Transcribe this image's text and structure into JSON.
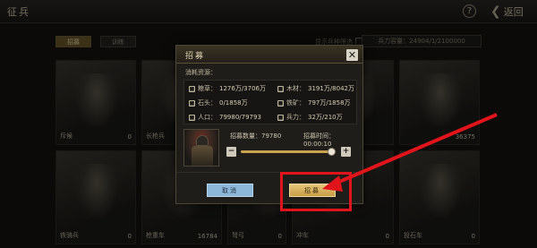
{
  "header": {
    "title": "征兵",
    "help_label": "?",
    "back_label": "返回"
  },
  "tabs": [
    {
      "label": "招募"
    },
    {
      "label": "训练"
    }
  ],
  "filter": {
    "label": "显示兵种筛选"
  },
  "troops_total": "兵力容量：24904/1/2100000",
  "troops": [
    {
      "name": "斥候",
      "count": "0"
    },
    {
      "name": "长枪兵",
      "count": "0"
    },
    {
      "name": "",
      "count": ""
    },
    {
      "name": "",
      "count": ""
    },
    {
      "name": "",
      "count": ""
    },
    {
      "name": "",
      "count": "36375"
    },
    {
      "name": "铁骑兵",
      "count": "0"
    },
    {
      "name": "枪重车",
      "count": "16784"
    },
    {
      "name": "弩弓",
      "count": "0"
    },
    {
      "name": "冲车",
      "count": "0"
    },
    {
      "name": "",
      "count": "0"
    },
    {
      "name": "投石车",
      "count": "0"
    }
  ],
  "dialog": {
    "title": "招募",
    "consume_label": "消耗资源：",
    "resources": [
      {
        "icon": "grain-icon",
        "label": "粮草：",
        "value": "1276万/3706万"
      },
      {
        "icon": "wood-icon",
        "label": "木材：",
        "value": "3191万/8042万"
      },
      {
        "icon": "stone-icon",
        "label": "石头：",
        "value": "0/1858万"
      },
      {
        "icon": "iron-icon",
        "label": "铁矿：",
        "value": "797万/1858万"
      },
      {
        "icon": "population-icon",
        "label": "人口：",
        "value": "79980/79793"
      },
      {
        "icon": "troops-icon",
        "label": "兵力：",
        "value": "32万/210万"
      }
    ],
    "recruit_amount_label": "招募数量：",
    "recruit_amount": "79780",
    "recruit_time_label": "招募时间：",
    "recruit_time": "00:00:10",
    "slider_value": 0.95,
    "minus_label": "−",
    "plus_label": "+",
    "close_label": "✕",
    "cancel_label": "取消",
    "confirm_label": "招募"
  },
  "colors": {
    "highlight": "#e0141a",
    "confirm_button": "#d8b062",
    "cancel_button": "#8db7d9"
  }
}
